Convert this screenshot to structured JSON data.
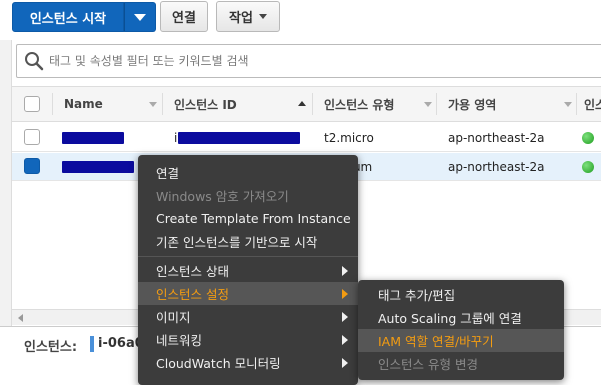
{
  "toolbar": {
    "launch_label": "인스턴스 시작",
    "connect_label": "연결",
    "actions_label": "작업"
  },
  "search": {
    "placeholder": "태그 및 속성별 필터 또는 키워드별 검색"
  },
  "table": {
    "columns": [
      "Name",
      "인스턴스 ID",
      "인스턴스 유형",
      "가용 영역",
      "인스"
    ],
    "rows": [
      {
        "instance_type": "t2.micro",
        "zone": "ap-northeast-2a",
        "selected": false
      },
      {
        "instance_type": "dium",
        "zone": "ap-northeast-2a",
        "selected": true
      }
    ]
  },
  "bottom": {
    "label": "인스턴스:",
    "value": "i-06a0"
  },
  "context_menu": {
    "items": [
      {
        "label": "연결"
      },
      {
        "label": "Windows 암호 가져오기"
      },
      {
        "label": "Create Template From Instance"
      },
      {
        "label": "기존 인스턴스를 기반으로 시작"
      },
      {
        "label": "인스턴스 상태"
      },
      {
        "label": "인스턴스 설정"
      },
      {
        "label": "이미지"
      },
      {
        "label": "네트워킹"
      },
      {
        "label": "CloudWatch 모니터링"
      }
    ]
  },
  "submenu": {
    "items": [
      {
        "label": "태그 추가/편집"
      },
      {
        "label": "Auto Scaling 그룹에 연결"
      },
      {
        "label": "IAM 역할 연결/바꾸기"
      },
      {
        "label": "인스턴스 유형 변경"
      }
    ]
  },
  "colors": {
    "primary": "#1166bb",
    "menu_bg": "#3c3c3c",
    "menu_highlight": "#f39c12",
    "status_running": "#2db52d"
  }
}
